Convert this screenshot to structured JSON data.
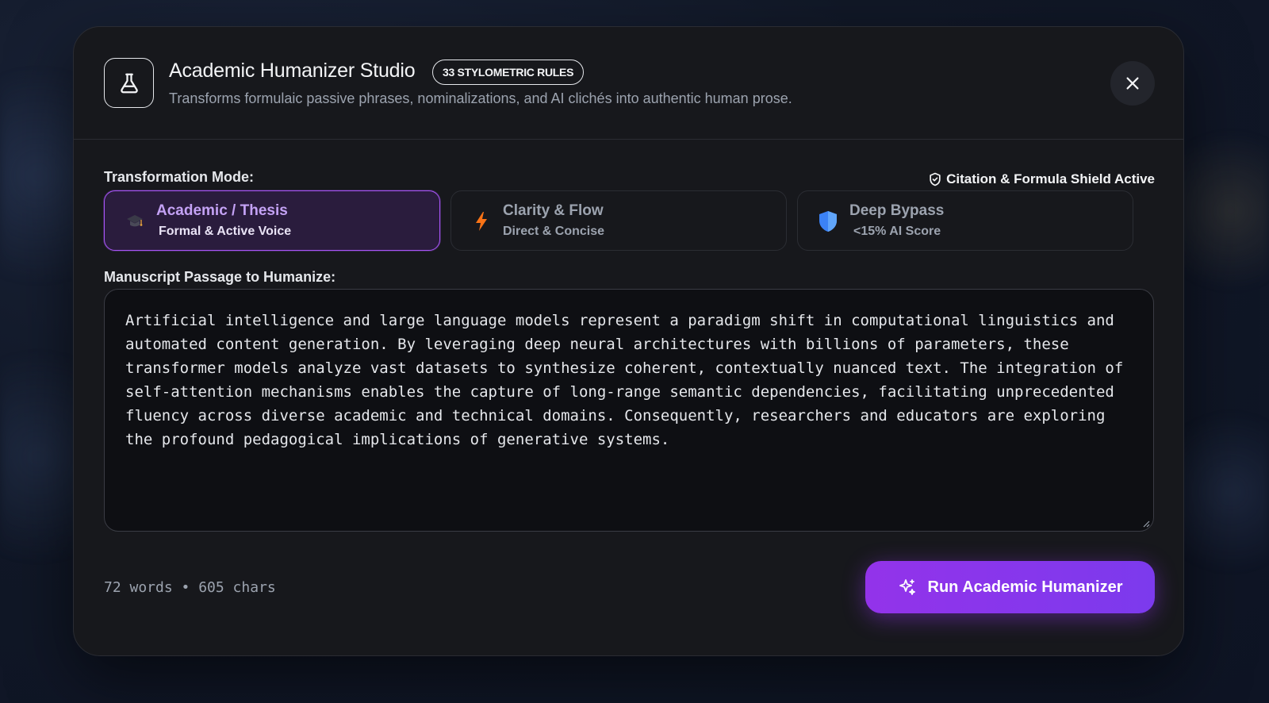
{
  "header": {
    "title": "Academic Humanizer Studio",
    "badge": "33 STYLOMETRIC RULES",
    "subtitle": "Transforms formulaic passive phrases, nominalizations, and AI clichés into authentic human prose."
  },
  "modes": {
    "label": "Transformation Mode:",
    "shield_status": "Citation & Formula Shield Active",
    "items": [
      {
        "title": "Academic / Thesis",
        "subtitle": "Formal & Active Voice",
        "icon": "graduation-cap-icon",
        "active": true
      },
      {
        "title": "Clarity & Flow",
        "subtitle": "Direct & Concise",
        "icon": "lightning-icon",
        "active": false
      },
      {
        "title": "Deep Bypass",
        "subtitle": "<15% AI Score",
        "icon": "shield-icon",
        "active": false
      }
    ]
  },
  "manuscript": {
    "label": "Manuscript Passage to Humanize:",
    "text": "Artificial intelligence and large language models represent a paradigm shift in computational linguistics and automated content generation. By leveraging deep neural architectures with billions of parameters, these transformer models analyze vast datasets to synthesize coherent, contextually nuanced text. The integration of self-attention mechanisms enables the capture of long-range semantic dependencies, facilitating unprecedented fluency across diverse academic and technical domains. Consequently, researchers and educators are exploring the profound pedagogical implications of generative systems."
  },
  "footer": {
    "counter": "72 words • 605 chars",
    "run_label": "Run Academic Humanizer"
  },
  "colors": {
    "accent": "#a855f7",
    "button": "#8b35f0",
    "bolt": "#f97316",
    "shield": "#3b82f6"
  }
}
